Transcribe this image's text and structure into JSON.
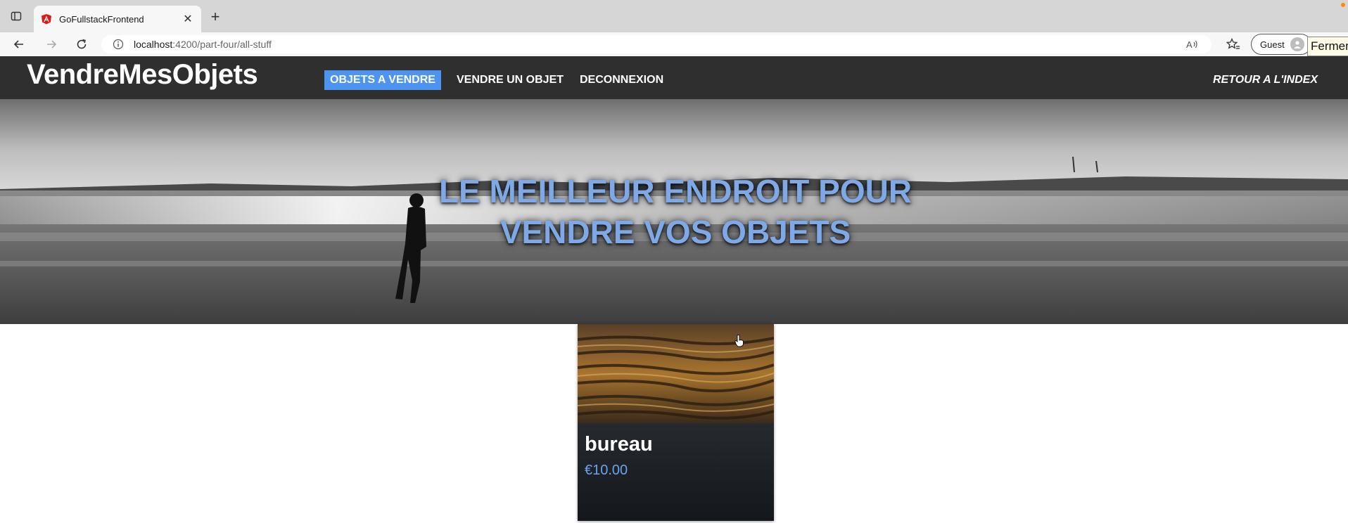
{
  "browser": {
    "tab_title": "GoFullstackFrontend",
    "url_host": "localhost",
    "url_path": ":4200/part-four/all-stuff",
    "profile_label": "Guest",
    "tooltip": "Fermer"
  },
  "nav": {
    "brand": "VendreMesObjets",
    "links": [
      "OBJETS A VENDRE",
      "VENDRE UN OBJET",
      "DECONNEXION"
    ],
    "active_index": 0,
    "right_link": "RETOUR A L'INDEX",
    "accent_color": "#4c94f0",
    "bar_color": "#2f2f2f"
  },
  "hero": {
    "title_line1": "LE MEILLEUR ENDROIT POUR",
    "title_line2": "VENDRE VOS OBJETS",
    "title_color": "#7ea8e6"
  },
  "products": [
    {
      "title": "bureau",
      "price": "€10.00"
    }
  ],
  "icons": [
    "sidebar-toggle-icon",
    "angular-favicon-icon",
    "close-icon",
    "plus-icon",
    "back-arrow-icon",
    "forward-arrow-icon",
    "reload-icon",
    "info-icon",
    "read-aloud-icon",
    "favorites-icon",
    "avatar-icon",
    "hand-cursor-icon"
  ]
}
